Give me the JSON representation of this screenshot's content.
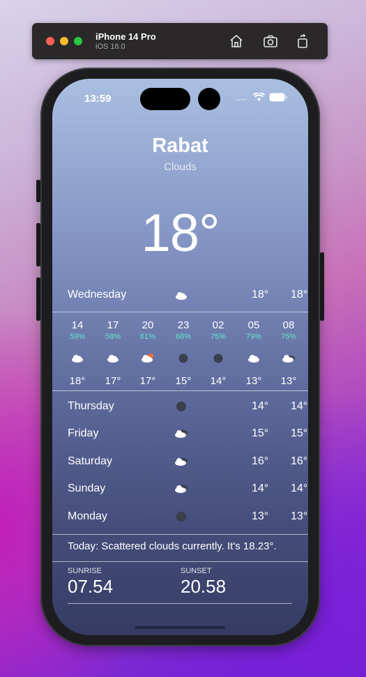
{
  "simulator": {
    "device_name": "iPhone 14 Pro",
    "os_version": "iOS 16.0"
  },
  "status_bar": {
    "time": "13:59"
  },
  "weather": {
    "city": "Rabat",
    "condition": "Clouds",
    "temperature": "18°",
    "today_row": {
      "day": "Wednesday",
      "icon": "cloud-icon",
      "min": "18°",
      "max": "18°"
    },
    "hourly": [
      {
        "hour": "14",
        "humidity": "59%",
        "icon": "cloud-icon",
        "temp": "18°"
      },
      {
        "hour": "17",
        "humidity": "58%",
        "icon": "cloud-icon",
        "temp": "17°"
      },
      {
        "hour": "20",
        "humidity": "61%",
        "icon": "cloud-sun-icon",
        "temp": "17°"
      },
      {
        "hour": "23",
        "humidity": "68%",
        "icon": "overcast-dot-icon",
        "temp": "15°"
      },
      {
        "hour": "02",
        "humidity": "75%",
        "icon": "overcast-dot-icon",
        "temp": "14°"
      },
      {
        "hour": "05",
        "humidity": "79%",
        "icon": "cloud-icon",
        "temp": "13°"
      },
      {
        "hour": "08",
        "humidity": "75%",
        "icon": "broken-clouds-icon",
        "temp": "13°"
      }
    ],
    "daily": [
      {
        "day": "Thursday",
        "icon": "overcast-dot-icon",
        "min": "14°",
        "max": "14°"
      },
      {
        "day": "Friday",
        "icon": "broken-clouds-icon",
        "min": "15°",
        "max": "15°"
      },
      {
        "day": "Saturday",
        "icon": "broken-clouds-icon",
        "min": "16°",
        "max": "16°"
      },
      {
        "day": "Sunday",
        "icon": "broken-clouds-icon",
        "min": "14°",
        "max": "14°"
      },
      {
        "day": "Monday",
        "icon": "overcast-dot-icon",
        "min": "13°",
        "max": "13°"
      }
    ],
    "summary": "Today: Scattered clouds currently. It's 18.23°.",
    "sunrise_label": "SUNRISE",
    "sunrise": "07.54",
    "sunset_label": "SUNSET",
    "sunset": "20.58"
  },
  "colors": {
    "humidity_accent": "#5fe8d2",
    "traffic_red": "#fe5f57",
    "traffic_yellow": "#febc2e",
    "traffic_green": "#28c840"
  }
}
